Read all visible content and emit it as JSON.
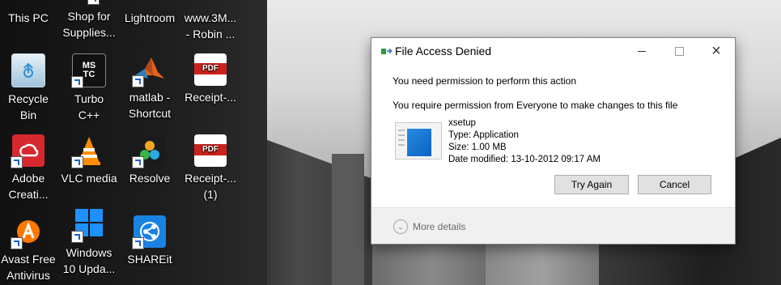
{
  "desktop": {
    "icons": [
      {
        "id": "this-pc",
        "label": "This PC"
      },
      {
        "id": "shop",
        "label": "Shop for\nSupplies..."
      },
      {
        "id": "lightroom",
        "label": "Lightroom"
      },
      {
        "id": "www3m",
        "label": "www.3M...\n- Robin ..."
      },
      {
        "id": "recycle",
        "label": "Recycle\nBin"
      },
      {
        "id": "turbo",
        "label": "Turbo\nC++",
        "glyph_text": "MS\nTC"
      },
      {
        "id": "matlab",
        "label": "matlab -\nShortcut"
      },
      {
        "id": "receipt1",
        "label": "Receipt-...",
        "glyph_text": "PDF"
      },
      {
        "id": "adobe",
        "label": "Adobe\nCreati..."
      },
      {
        "id": "vlc",
        "label": "VLC media"
      },
      {
        "id": "resolve",
        "label": "Resolve"
      },
      {
        "id": "receipt2",
        "label": "Receipt-...\n(1)",
        "glyph_text": "PDF"
      },
      {
        "id": "avast",
        "label": "Avast Free\nAntivirus"
      },
      {
        "id": "windows",
        "label": "Windows\n10 Upda..."
      },
      {
        "id": "shareit",
        "label": "SHAREit"
      }
    ]
  },
  "dialog": {
    "title": "File Access Denied",
    "icon": "file-move-icon",
    "controls": {
      "minimize": "minimize-icon",
      "maximize": "maximize-icon",
      "close": "×"
    },
    "message": "You need permission to perform this action",
    "detail": "You require permission from Everyone to make changes to this file",
    "file": {
      "name": "xsetup",
      "type": "Type: Application",
      "size": "Size: 1.00 MB",
      "modified": "Date modified: 13-10-2012 09:17 AM"
    },
    "buttons": {
      "try_again": "Try Again",
      "cancel": "Cancel"
    },
    "more_details": "More details",
    "colors": {
      "accent": "#0a62c4",
      "button_bg": "#e1e1e1",
      "footer_bg": "#f0f0f0"
    }
  }
}
